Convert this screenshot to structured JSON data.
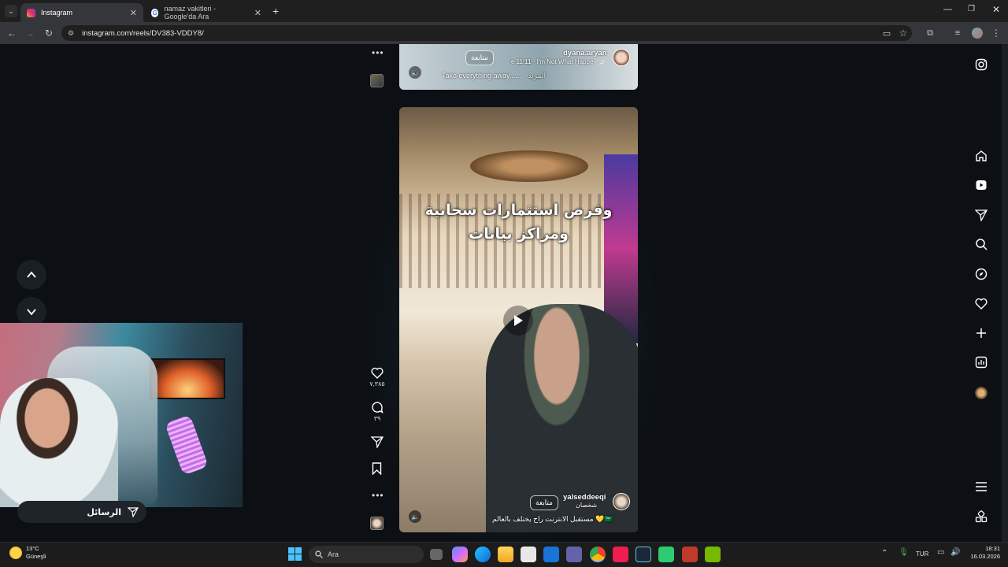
{
  "browser": {
    "tabs": [
      {
        "label": "Instagram",
        "active": true
      },
      {
        "label": "namaz vakitleri - Google'da Ara",
        "active": false
      }
    ],
    "url": "instagram.com/reels/DV383-VDDY8/"
  },
  "prev_reel": {
    "username": "dyana.aryan",
    "follow": "متابعة",
    "song": "e 11:11 · I'm Not What Happe",
    "caption": "Take everything away......",
    "more": "المزيد"
  },
  "main_reel": {
    "overlay_line1": "وفرص استثمارات سحابية",
    "overlay_line2": "ومراكز بيانات",
    "username": "yalseddeeqi",
    "follow": "متابعة",
    "subtitle": "شخصان",
    "caption": "مستقبل الانترنت راح يختلف بالعالم 💛🇸🇦"
  },
  "actions": {
    "likes": "٧,٣٨٥",
    "comments": "٣٩"
  },
  "messages_bar": {
    "label": "الرسائل"
  },
  "taskbar": {
    "weather_temp": "13°C",
    "weather_desc": "Güneşli",
    "search_label": "Ara",
    "language": "TUR",
    "time": "18:31",
    "date": "16.03.2026"
  },
  "colors": {
    "page_bg": "#0c1014",
    "chrome_dark": "#1f1f1f",
    "chrome_toolbar": "#35363a",
    "taskbar_bg": "#1c1c1c"
  }
}
